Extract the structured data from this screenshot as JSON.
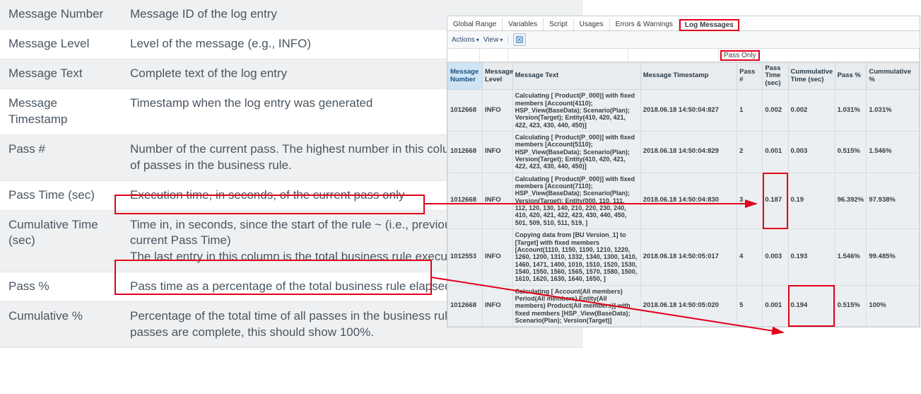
{
  "definitions": [
    {
      "term": "Message Number",
      "desc": "Message ID of the log entry"
    },
    {
      "term": "Message Level",
      "desc": "Level of the message (e.g., INFO)"
    },
    {
      "term": "Message Text",
      "desc": "Complete text of the log entry"
    },
    {
      "term": "Message Timestamp",
      "desc": "Timestamp when the log entry was generated"
    },
    {
      "term": "Pass #",
      "desc": "Number of the current pass.  The highest number in this column is the total number of passes in the business rule."
    },
    {
      "term": "Pass Time (sec)",
      "desc": "Execution time, in seconds, of the current pass only"
    },
    {
      "term": "Cumulative Time (sec)",
      "desc_a": "Time in, in seconds, since the start of the rule ~ (i.e., previous Cumulative Time + current Pass Time)",
      "desc_b": "The last entry in this column is the total business rule execution time"
    },
    {
      "term": "Pass %",
      "desc": "Pass time as a percentage of the total business rule elapsed time"
    },
    {
      "term": "Cumulative %",
      "desc": "Percentage of the total time of all passes in the business rule to that line When all passes are complete, this should show 100%."
    }
  ],
  "panel": {
    "tabs": [
      "Global Range",
      "Variables",
      "Script",
      "Usages",
      "Errors & Warnings",
      "Log Messages"
    ],
    "selected_tab": "Log Messages",
    "toolbar": {
      "actions": "Actions",
      "view": "View"
    },
    "filter_label": "Pass Only",
    "columns": [
      "Message Number",
      "Message Level",
      "Message Text",
      "Message Timestamp",
      "Pass #",
      "Pass Time (sec)",
      "Cummulative Time (sec)",
      "Pass %",
      "Cummulative %"
    ],
    "rows": [
      {
        "num": "1012668",
        "lvl": "INFO",
        "text": "Calculating [ Product(P_000)] with fixed members [Account(4110); HSP_View(BaseData); Scenario(Plan); Version(Target); Entity(410, 420, 421, 422, 423, 430, 440, 450)]",
        "ts": "2018.06.18 14:50:04:827",
        "pass": "1",
        "pt": "0.002",
        "ct": "0.002",
        "pp": "1.031%",
        "cp": "1.031%"
      },
      {
        "num": "1012668",
        "lvl": "INFO",
        "text": "Calculating [ Product(P_000)] with fixed members [Account(5110); HSP_View(BaseData); Scenario(Plan); Version(Target); Entity(410, 420, 421, 422, 423, 430, 440, 450)]",
        "ts": "2018.06.18 14:50:04:829",
        "pass": "2",
        "pt": "0.001",
        "ct": "0.003",
        "pp": "0.515%",
        "cp": "1.546%"
      },
      {
        "num": "1012668",
        "lvl": "INFO",
        "text": "Calculating [ Product(P_000)] with fixed members [Account(7110); HSP_View(BaseData); Scenario(Plan); Version(Target); Entity(000, 110, 111, 112, 120, 130, 140, 210, 220, 230, 240, 410, 420, 421, 422, 423, 430, 440, 450, 501, 509, 510, 511, 519, ]",
        "ts": "2018.06.18 14:50:04:830",
        "pass": "3",
        "pt": "0.187",
        "ct": "0.19",
        "pp": "96.392%",
        "cp": "97.938%",
        "hl_pt": true
      },
      {
        "num": "1012553",
        "lvl": "INFO",
        "text": "Copying data from [BU Version_1] to [Target] with fixed members [Account(1110, 1150, 1100, 1210, 1220, 1260, 1200, 1310, 1332, 1340, 1300, 1410, 1460, 1471, 1400, 1010, 1510, 1520, 1530, 1540, 1550, 1560, 1565, 1570, 1580, 1500, 1610, 1620, 1630, 1640, 1650, ]",
        "ts": "2018.06.18 14:50:05:017",
        "pass": "4",
        "pt": "0.003",
        "ct": "0.193",
        "pp": "1.546%",
        "cp": "99.485%"
      },
      {
        "num": "1012668",
        "lvl": "INFO",
        "text": "Calculating [ Account(All members) Period(All members) Entity(All members) Product(All members)] with fixed members [HSP_View(BaseData); Scenario(Plan); Version(Target)]",
        "ts": "2018.06.18 14:50:05:020",
        "pass": "5",
        "pt": "0.001",
        "ct": "0.194",
        "pp": "0.515%",
        "cp": "100%",
        "hl_ct": true
      }
    ]
  }
}
